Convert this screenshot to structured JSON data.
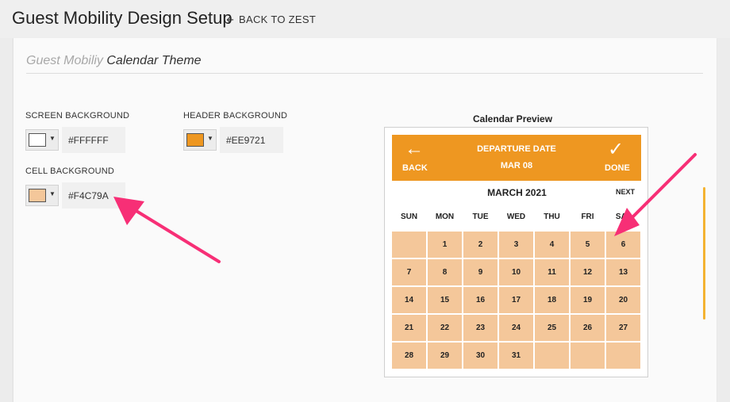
{
  "header": {
    "title": "Guest Mobility Design Setup",
    "back_label": "BACK TO ZEST"
  },
  "section": {
    "title_light": "Guest Mobiliy",
    "title_dark": "Calendar Theme"
  },
  "fields": {
    "screen_background": {
      "label": "SCREEN BACKGROUND",
      "value": "#FFFFFF",
      "color": "#FFFFFF"
    },
    "header_background": {
      "label": "HEADER BACKGROUND",
      "value": "#EE9721",
      "color": "#EE9721"
    },
    "cell_background": {
      "label": "CELL BACKGROUND",
      "value": "#F4C79A",
      "color": "#F4C79A"
    }
  },
  "preview": {
    "label": "Calendar Preview",
    "back_label": "BACK",
    "done_label": "DONE",
    "header_title": "DEPARTURE DATE",
    "header_date": "MAR 08",
    "month": "MARCH 2021",
    "next_label": "NEXT",
    "weekdays": [
      "SUN",
      "MON",
      "TUE",
      "WED",
      "THU",
      "FRI",
      "SAT"
    ],
    "days": [
      "",
      "1",
      "2",
      "3",
      "4",
      "5",
      "6",
      "7",
      "8",
      "9",
      "10",
      "11",
      "12",
      "13",
      "14",
      "15",
      "16",
      "17",
      "18",
      "19",
      "20",
      "21",
      "22",
      "23",
      "24",
      "25",
      "26",
      "27",
      "28",
      "29",
      "30",
      "31",
      "",
      "",
      ""
    ]
  },
  "colors": {
    "annotation_arrow": "#F72F76",
    "scroll_accent": "#F4B331"
  },
  "icons": {
    "back": "left-arrow-icon",
    "done": "checkmark-icon",
    "dropdown": "caret-down-icon"
  }
}
